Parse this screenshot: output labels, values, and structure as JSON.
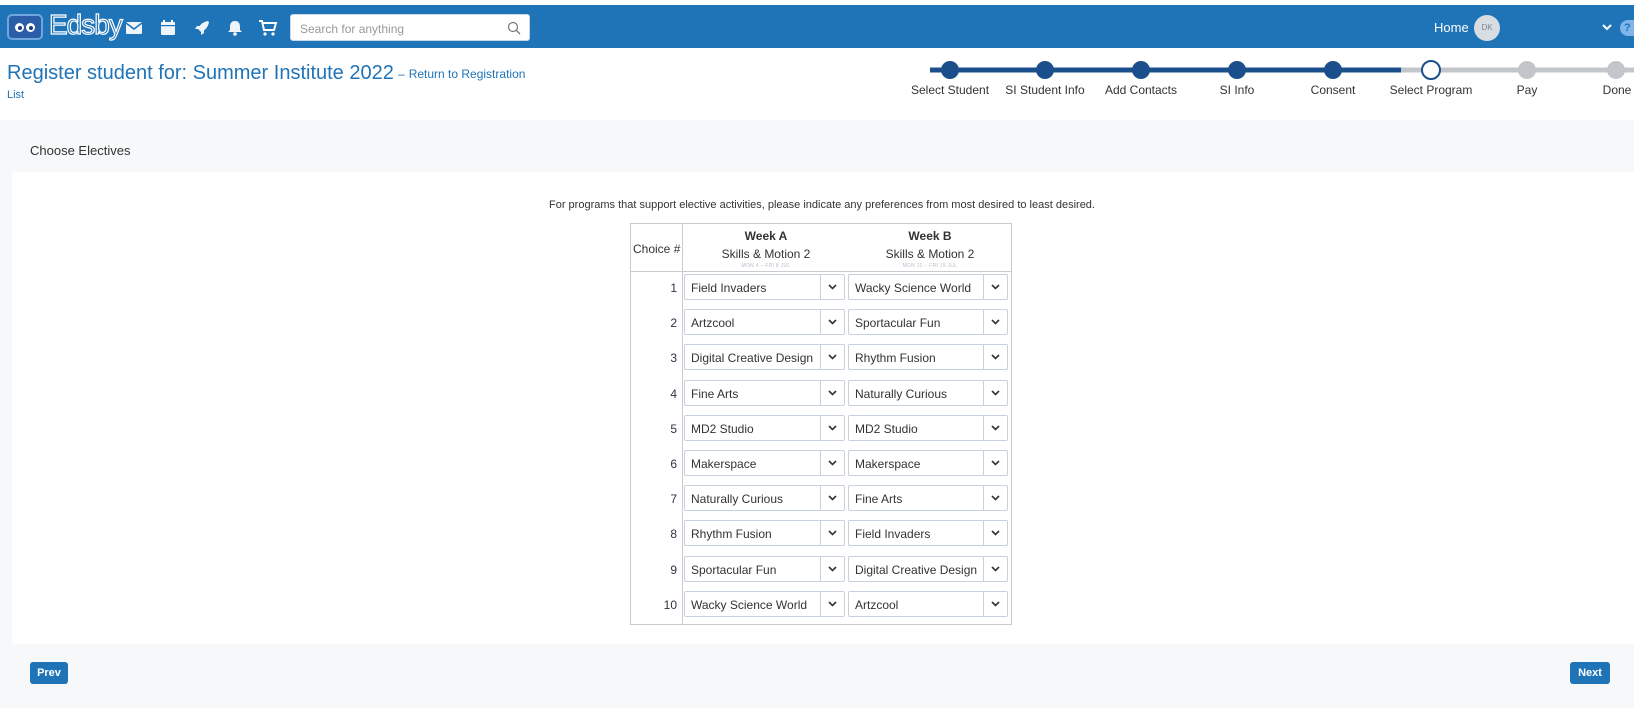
{
  "app": {
    "logo_text": "Edsby",
    "search_placeholder": "Search for anything",
    "home_label": "Home",
    "avatar_initials": "DK",
    "help_glyph": "?"
  },
  "header": {
    "title": "Register student for: Summer Institute 2022",
    "return_link_line1": "Return to Registration",
    "return_link_line2": "List",
    "dash": "–"
  },
  "stepper": {
    "steps": [
      {
        "label": "Select Student",
        "state": "done"
      },
      {
        "label": "SI Student Info",
        "state": "done"
      },
      {
        "label": "Add Contacts",
        "state": "done"
      },
      {
        "label": "SI Info",
        "state": "done"
      },
      {
        "label": "Consent",
        "state": "done"
      },
      {
        "label": "Select Program",
        "state": "current"
      },
      {
        "label": "Pay",
        "state": "todo"
      },
      {
        "label": "Done",
        "state": "todo"
      }
    ],
    "colors": {
      "done": "#1b4f8c",
      "todo": "#c2c6cb"
    }
  },
  "section": {
    "title": "Choose Electives",
    "instructions": "For programs that support elective activities, please indicate any preferences from most desired to least desired."
  },
  "table": {
    "choice_header": "Choice #",
    "weeks": [
      {
        "week": "Week A",
        "program": "Skills & Motion 2",
        "dates": "MON 4 – FRI 8 JUL"
      },
      {
        "week": "Week B",
        "program": "Skills & Motion 2",
        "dates": "MON 11 – FRI 15 JUL"
      }
    ],
    "rows": [
      {
        "num": "1",
        "a": "Field Invaders",
        "b": "Wacky Science World"
      },
      {
        "num": "2",
        "a": "Artzcool",
        "b": "Sportacular Fun"
      },
      {
        "num": "3",
        "a": "Digital Creative Design",
        "b": "Rhythm Fusion"
      },
      {
        "num": "4",
        "a": "Fine Arts",
        "b": "Naturally Curious"
      },
      {
        "num": "5",
        "a": "MD2 Studio",
        "b": "MD2 Studio"
      },
      {
        "num": "6",
        "a": "Makerspace",
        "b": "Makerspace"
      },
      {
        "num": "7",
        "a": "Naturally Curious",
        "b": "Fine Arts"
      },
      {
        "num": "8",
        "a": "Rhythm Fusion",
        "b": "Field Invaders"
      },
      {
        "num": "9",
        "a": "Sportacular Fun",
        "b": "Digital Creative Design"
      },
      {
        "num": "10",
        "a": "Wacky Science World",
        "b": "Artzcool"
      }
    ]
  },
  "nav": {
    "prev_label": "Prev",
    "next_label": "Next"
  },
  "colors": {
    "brand": "#1f73b7",
    "stepper_done": "#1b4f8c"
  }
}
